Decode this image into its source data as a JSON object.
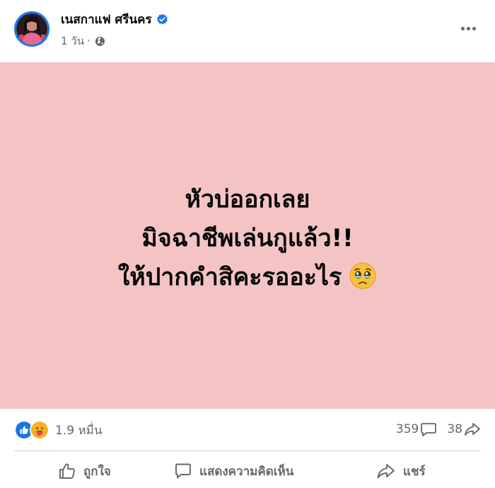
{
  "post": {
    "author_name": "เนสกาแฟ ศรีนคร",
    "time": "1 วัน",
    "separator": "·",
    "audience_icon": "globe-icon",
    "verified_icon": "verified-badge-icon",
    "more_icon": "more-options-icon",
    "background_color": "#f4c4c4",
    "text_lines": [
      "หัวบ่ออกเลย",
      "มิจฉาชีพเล่นกูแล้ว!!",
      "ให้ปากคำสิคะรออะไร"
    ],
    "emoji": "pleading-face-emoji"
  },
  "stats": {
    "reaction_icons": [
      "like-reaction-icon",
      "care-reaction-icon"
    ],
    "reactions_count": "1.9 หมื่น",
    "comments_count": "359",
    "comment_icon": "comment-icon",
    "shares_count": "38",
    "share_icon": "share-icon"
  },
  "actions": {
    "like_label": "ถูกใจ",
    "comment_label": "แสดงความคิดเห็น",
    "share_label": "แชร์"
  },
  "colors": {
    "accent": "#1877f2",
    "muted_text": "#65676b",
    "divider": "#ced0d4"
  }
}
